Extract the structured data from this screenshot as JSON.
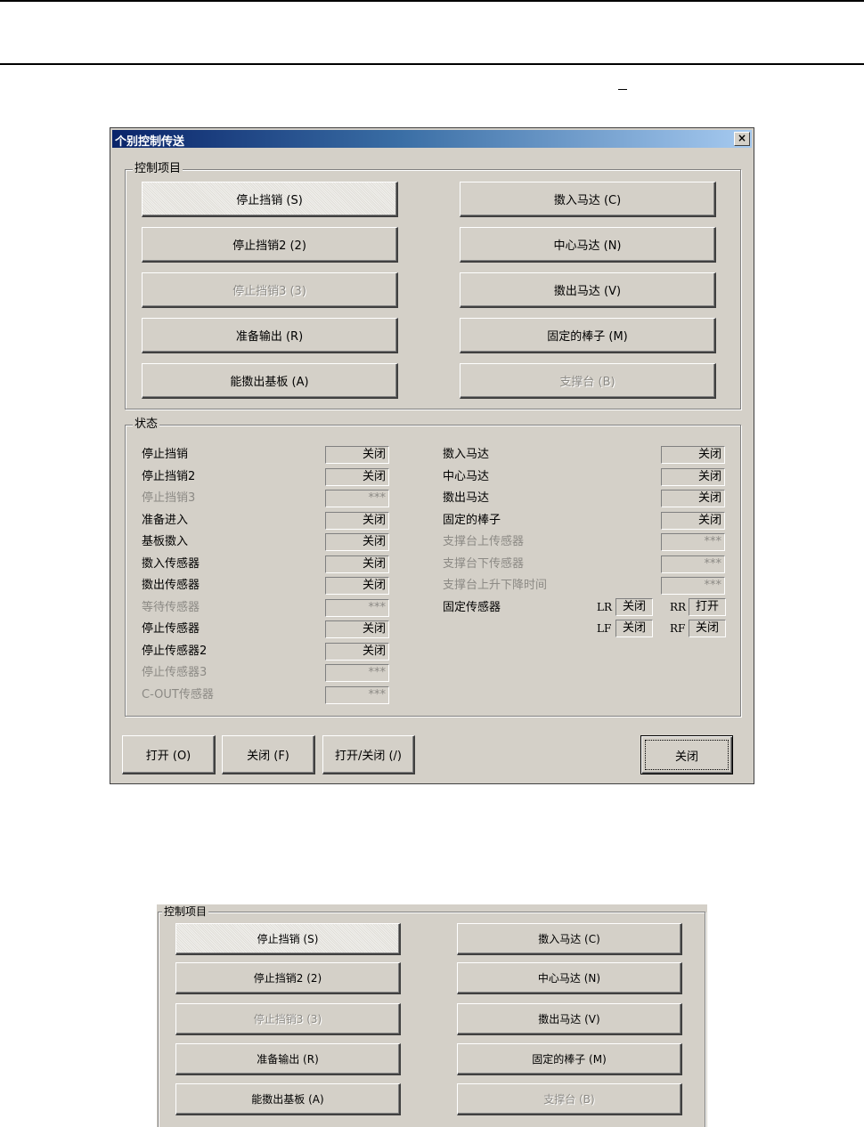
{
  "dialog": {
    "title": "个别控制传送",
    "close_symbol": "×"
  },
  "control_group": {
    "label": "控制项目",
    "buttons": [
      {
        "label": "停止挡销 (S)",
        "enabled": true,
        "focused": true
      },
      {
        "label": "擞入马达 (C)",
        "enabled": true
      },
      {
        "label": "停止挡销2 (2)",
        "enabled": true
      },
      {
        "label": "中心马达 (N)",
        "enabled": true
      },
      {
        "label": "停止挡销3 (3)",
        "enabled": false
      },
      {
        "label": "擞出马达 (V)",
        "enabled": true
      },
      {
        "label": "准备输出 (R)",
        "enabled": true
      },
      {
        "label": "固定的棒子 (M)",
        "enabled": true
      },
      {
        "label": "能擞出基板 (A)",
        "enabled": true
      },
      {
        "label": "支撑台 (B)",
        "enabled": false
      }
    ]
  },
  "status_group": {
    "label": "状态",
    "left": [
      {
        "name": "停止挡销",
        "value": "关闭",
        "enabled": true
      },
      {
        "name": "停止挡销2",
        "value": "关闭",
        "enabled": true
      },
      {
        "name": "停止挡销3",
        "value": "***",
        "enabled": false
      },
      {
        "name": "准备进入",
        "value": "关闭",
        "enabled": true
      },
      {
        "name": "基板擞入",
        "value": "关闭",
        "enabled": true
      },
      {
        "name": "擞入传感器",
        "value": "关闭",
        "enabled": true
      },
      {
        "name": "擞出传感器",
        "value": "关闭",
        "enabled": true
      },
      {
        "name": "等待传感器",
        "value": "***",
        "enabled": false
      },
      {
        "name": "停止传感器",
        "value": "关闭",
        "enabled": true
      },
      {
        "name": "停止传感器2",
        "value": "关闭",
        "enabled": true
      },
      {
        "name": "停止传感器3",
        "value": "***",
        "enabled": false
      },
      {
        "name": "C-OUT传感器",
        "value": "***",
        "enabled": false
      }
    ],
    "right": [
      {
        "name": "擞入马达",
        "value": "关闭",
        "enabled": true
      },
      {
        "name": "中心马达",
        "value": "关闭",
        "enabled": true
      },
      {
        "name": "擞出马达",
        "value": "关闭",
        "enabled": true
      },
      {
        "name": "固定的棒子",
        "value": "关闭",
        "enabled": true
      },
      {
        "name": "支撑台上传感器",
        "value": "***",
        "enabled": false
      },
      {
        "name": "支撑台下传感器",
        "value": "***",
        "enabled": false
      },
      {
        "name": "支撑台上升下降时间",
        "value": "***",
        "enabled": false
      }
    ],
    "fixed_sensor": {
      "name": "固定传感器",
      "LR": {
        "label": "LR",
        "value": "关闭"
      },
      "RR": {
        "label": "RR",
        "value": "打开"
      },
      "LF": {
        "label": "LF",
        "value": "关闭"
      },
      "RF": {
        "label": "RF",
        "value": "关闭"
      }
    }
  },
  "footer": {
    "open_label": "打开 (O)",
    "close_label": "关闭 (F)",
    "toggle_label": "打开/关闭 (/)",
    "dismiss_label": "关闭"
  },
  "colors": {
    "dialog_bg": "#d4d0c8",
    "titlebar_start": "#0a246a",
    "titlebar_end": "#a6caf0",
    "disabled_text": "#8c8a85"
  }
}
